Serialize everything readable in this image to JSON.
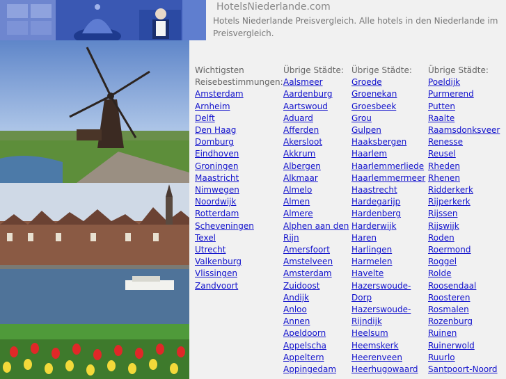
{
  "header": {
    "title": "HotelsNiederlande.com",
    "description": "Hotels Niederlande Preisvergleich. Alle hotels in den Niederlande im Preisvergleich."
  },
  "columns": [
    {
      "heading": [
        "Wichtigsten",
        "Reisebestimmungen:"
      ],
      "links": [
        "Amsterdam",
        "Arnheim",
        "Delft",
        "Den Haag",
        "Domburg",
        "Eindhoven",
        "Groningen",
        "Maastricht",
        "Nimwegen",
        "Noordwijk",
        "Rotterdam",
        "Scheveningen",
        "Texel",
        "Utrecht",
        "Valkenburg",
        "Vlissingen",
        "Zandvoort"
      ]
    },
    {
      "heading": [
        "Übrige Städte:"
      ],
      "links": [
        "Aalsmeer",
        "Aardenburg",
        "Aartswoud",
        "Aduard",
        "Afferden",
        "Akersloot",
        "Akkrum",
        "Albergen",
        "Alkmaar",
        "Almelo",
        "Almen",
        "Almere",
        "Alphen aan den",
        "Rijn",
        "Amersfoort",
        "Amstelveen",
        "Amsterdam",
        "Zuidoost",
        "Andijk",
        "Anloo",
        "Annen",
        "Apeldoorn",
        "Appelscha",
        "Appeltern",
        "Appingedam"
      ]
    },
    {
      "heading": [
        "Übrige Städte:"
      ],
      "links": [
        "Groede",
        "Groenekan",
        "Groesbeek",
        "Grou",
        "Gulpen",
        "Haaksbergen",
        "Haarlem",
        "Haarlemmerliede",
        "Haarlemmermeer",
        "Haastrecht",
        "Hardegarijp",
        "Hardenberg",
        "Harderwijk",
        "Haren",
        "Harlingen",
        "Harmelen",
        "Havelte",
        "Hazerswoude-",
        "Dorp",
        "Hazerswoude-",
        "Rijndijk",
        "Heelsum",
        "Heemskerk",
        "Heerenveen",
        "Heerhugowaard"
      ]
    },
    {
      "heading": [
        "Übrige Städte:"
      ],
      "links": [
        "Poeldijk",
        "Purmerend",
        "Putten",
        "Raalte",
        "Raamsdonksveer",
        "Renesse",
        "Reusel",
        "Rheden",
        "Rhenen",
        "Ridderkerk",
        "Rijperkerk",
        "Rijssen",
        "Rijswijk",
        "Roden",
        "Roermond",
        "Roggel",
        "Rolde",
        "Roosendaal",
        "Roosteren",
        "Rosmalen",
        "Rozenburg",
        "Ruinen",
        "Ruinerwold",
        "Ruurlo",
        "Santpoort-Noord"
      ]
    }
  ]
}
